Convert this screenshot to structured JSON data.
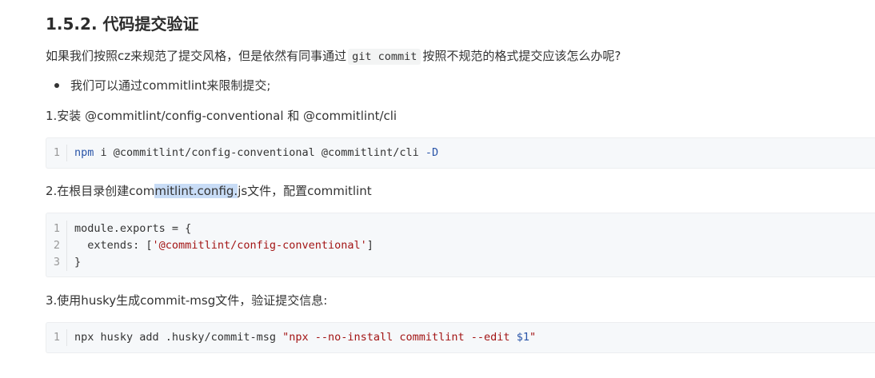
{
  "heading": "1.5.2. 代码提交验证",
  "intro": {
    "before": "如果我们按照cz来规范了提交风格，但是依然有同事通过",
    "code": "git commit",
    "after": "按照不规范的格式提交应该怎么办呢?"
  },
  "bullet": "我们可以通过commitlint来限制提交;",
  "step1": "1.安装 @commitlint/config-conventional 和 @commitlint/cli",
  "code1": {
    "lines": [
      {
        "num": "1",
        "cmd": "npm",
        "rest": " i @commitlint/config-conventional @commitlint/cli ",
        "flag": "-D"
      }
    ]
  },
  "step2": {
    "before": "2.在根目录创建com",
    "highlight": "mitlint.config.",
    "after": "js文件，配置commitlint"
  },
  "code2": {
    "lines": [
      {
        "num": "1",
        "text": "module.exports = {"
      },
      {
        "num": "2",
        "key": "  extends: [",
        "str": "'@commitlint/config-conventional'",
        "end": "]"
      },
      {
        "num": "3",
        "text": "}"
      }
    ]
  },
  "step3": "3.使用husky生成commit-msg文件，验证提交信息:",
  "code3": {
    "lines": [
      {
        "num": "1",
        "plain": "npx husky add .husky/commit-msg ",
        "str_open": "\"npx --no-install commitlint --edit ",
        "var": "$1",
        "str_close": "\""
      }
    ]
  }
}
